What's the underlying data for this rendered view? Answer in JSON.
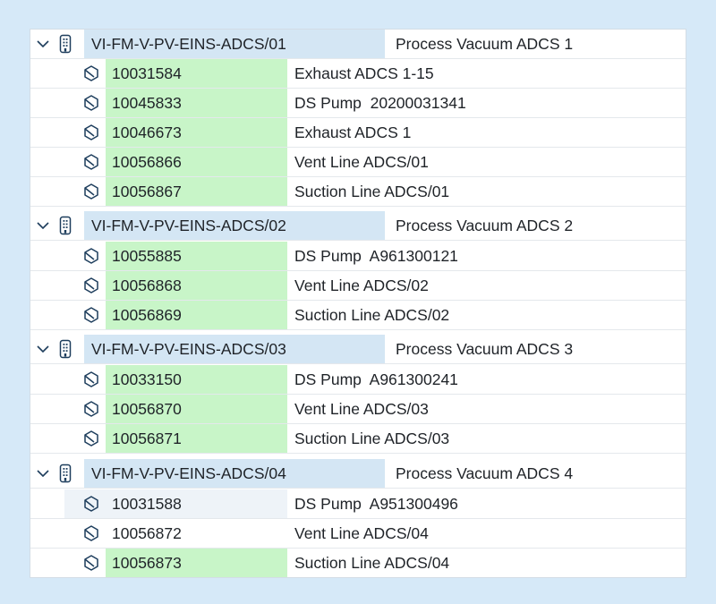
{
  "colors": {
    "background": "#d6e9f8",
    "group_header_fill": "#d4e6f4",
    "highlight_green": "#c8f5c8",
    "selection_pale": "#eef3f8",
    "icon_stroke": "#1d3d5c"
  },
  "icons": {
    "expand": "chevron-down-icon",
    "group": "building-icon",
    "item": "hexagon-box-icon"
  },
  "groups": [
    {
      "id": "VI-FM-V-PV-EINS-ADCS/01",
      "description": "Process Vacuum ADCS 1",
      "items": [
        {
          "number": "10031584",
          "description": "Exhaust ADCS 1-15",
          "highlight": "green"
        },
        {
          "number": "10045833",
          "description": "DS Pump  20200031341",
          "highlight": "green"
        },
        {
          "number": "10046673",
          "description": "Exhaust ADCS 1",
          "highlight": "green"
        },
        {
          "number": "10056866",
          "description": "Vent Line ADCS/01",
          "highlight": "green"
        },
        {
          "number": "10056867",
          "description": "Suction Line ADCS/01",
          "highlight": "green"
        }
      ]
    },
    {
      "id": "VI-FM-V-PV-EINS-ADCS/02",
      "description": "Process Vacuum ADCS 2",
      "items": [
        {
          "number": "10055885",
          "description": "DS Pump  A961300121",
          "highlight": "green"
        },
        {
          "number": "10056868",
          "description": "Vent Line ADCS/02",
          "highlight": "green"
        },
        {
          "number": "10056869",
          "description": "Suction Line ADCS/02",
          "highlight": "green"
        }
      ]
    },
    {
      "id": "VI-FM-V-PV-EINS-ADCS/03",
      "description": "Process Vacuum ADCS 3",
      "items": [
        {
          "number": "10033150",
          "description": "DS Pump  A961300241",
          "highlight": "green"
        },
        {
          "number": "10056870",
          "description": "Vent Line ADCS/03",
          "highlight": "green"
        },
        {
          "number": "10056871",
          "description": "Suction Line ADCS/03",
          "highlight": "green"
        }
      ]
    },
    {
      "id": "VI-FM-V-PV-EINS-ADCS/04",
      "description": "Process Vacuum ADCS 4",
      "items": [
        {
          "number": "10031588",
          "description": "DS Pump  A951300496",
          "highlight": "pale",
          "selected": true
        },
        {
          "number": "10056872",
          "description": "Vent Line ADCS/04",
          "highlight": "none"
        },
        {
          "number": "10056873",
          "description": "Suction Line ADCS/04",
          "highlight": "green"
        }
      ]
    }
  ]
}
